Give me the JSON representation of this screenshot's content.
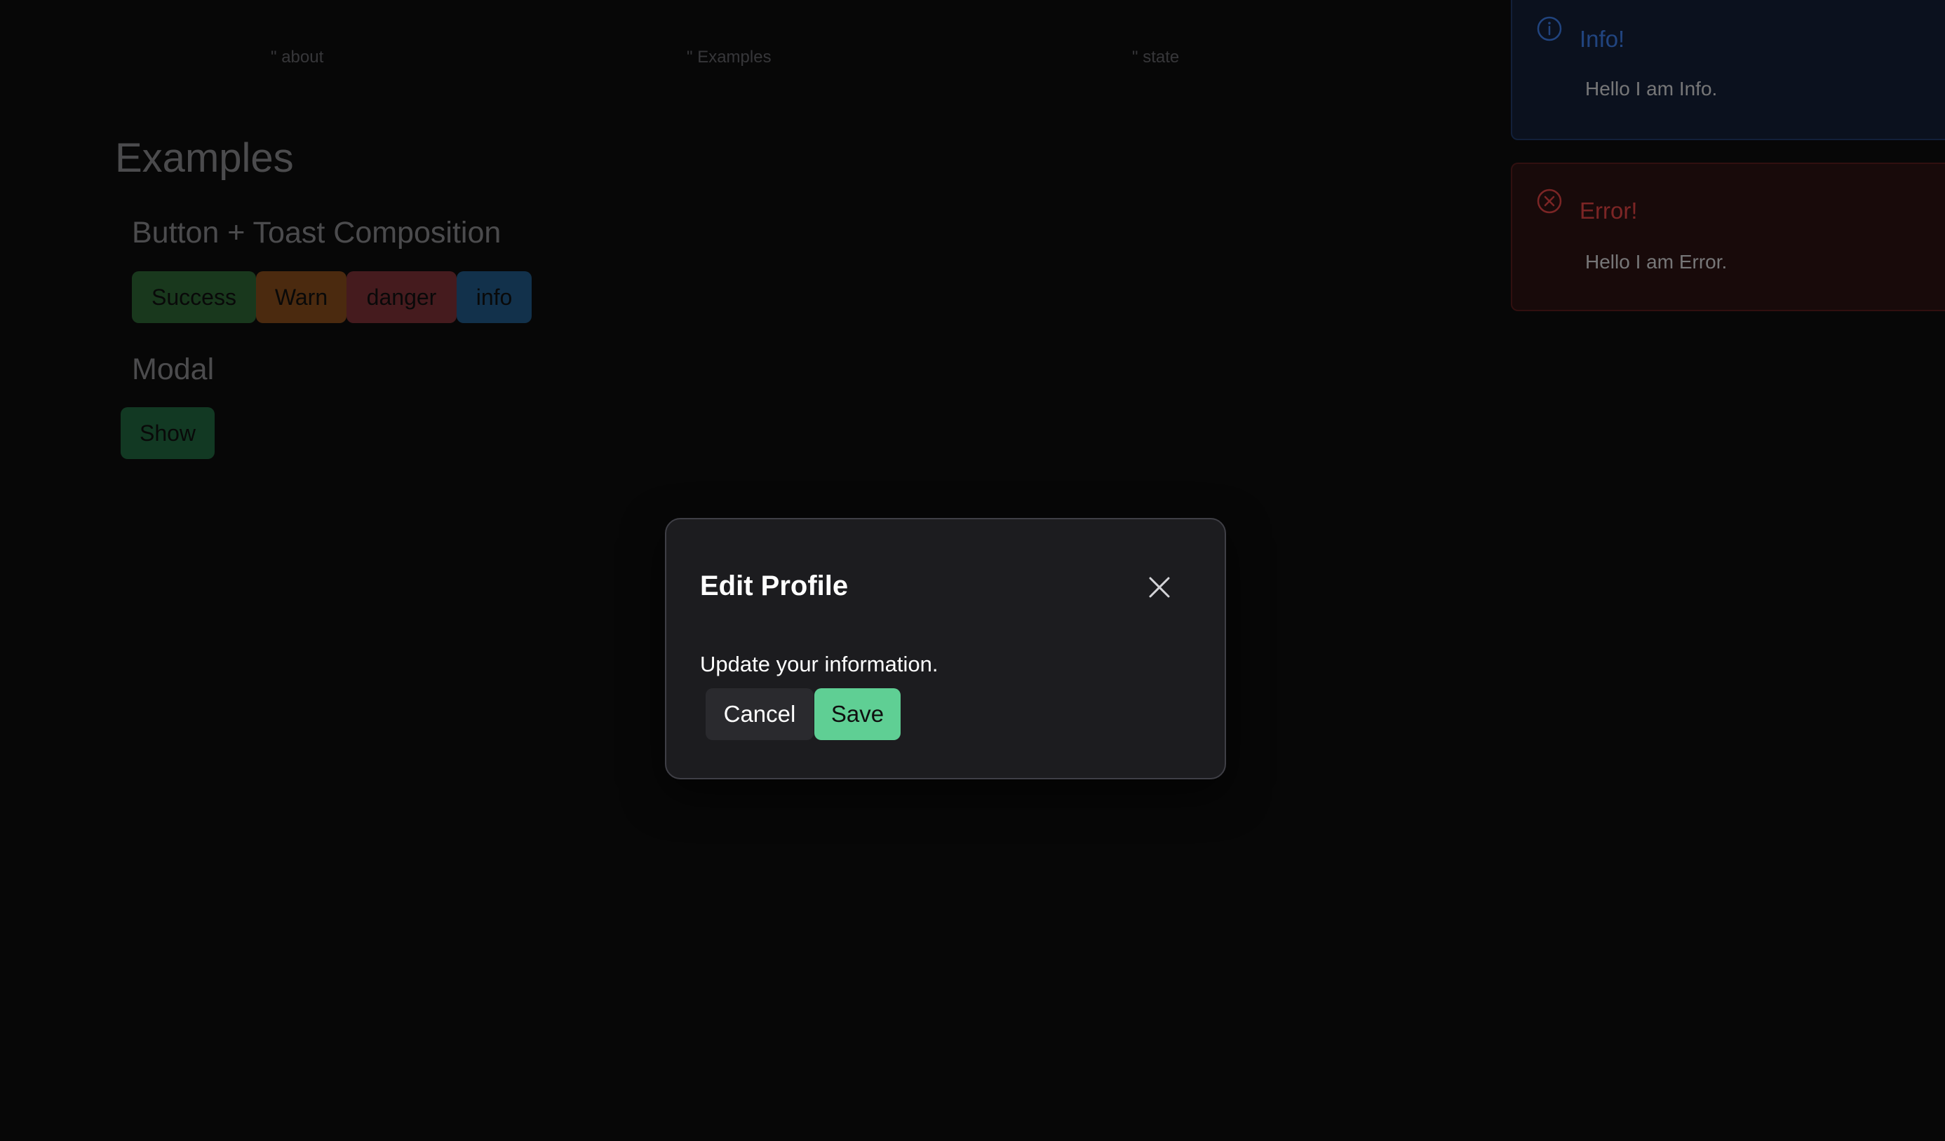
{
  "nav": {
    "about": "\" about",
    "examples": "\" Examples",
    "state": "\" state"
  },
  "main": {
    "title": "Examples",
    "toast_section": {
      "title": "Button + Toast Composition",
      "buttons": {
        "success": "Success",
        "warn": "Warn",
        "danger": "danger",
        "info": "info"
      }
    },
    "modal_section": {
      "title": "Modal",
      "show_label": "Show"
    }
  },
  "toasts": {
    "info": {
      "title": "Info!",
      "message": "Hello I am Info.",
      "icon": "info-circle-icon",
      "color": "#3b82f6"
    },
    "error": {
      "title": "Error!",
      "message": "Hello I am Error.",
      "icon": "x-circle-icon",
      "color": "#ef4444"
    }
  },
  "modal": {
    "title": "Edit Profile",
    "description": "Update your information.",
    "cancel_label": "Cancel",
    "save_label": "Save",
    "close_icon": "close-icon"
  },
  "colors": {
    "background": "#0a0a0a",
    "success": "#43a651",
    "warn": "#e07a22",
    "danger": "#d04a54",
    "info": "#2c8fe0",
    "save": "#5fcf94"
  }
}
